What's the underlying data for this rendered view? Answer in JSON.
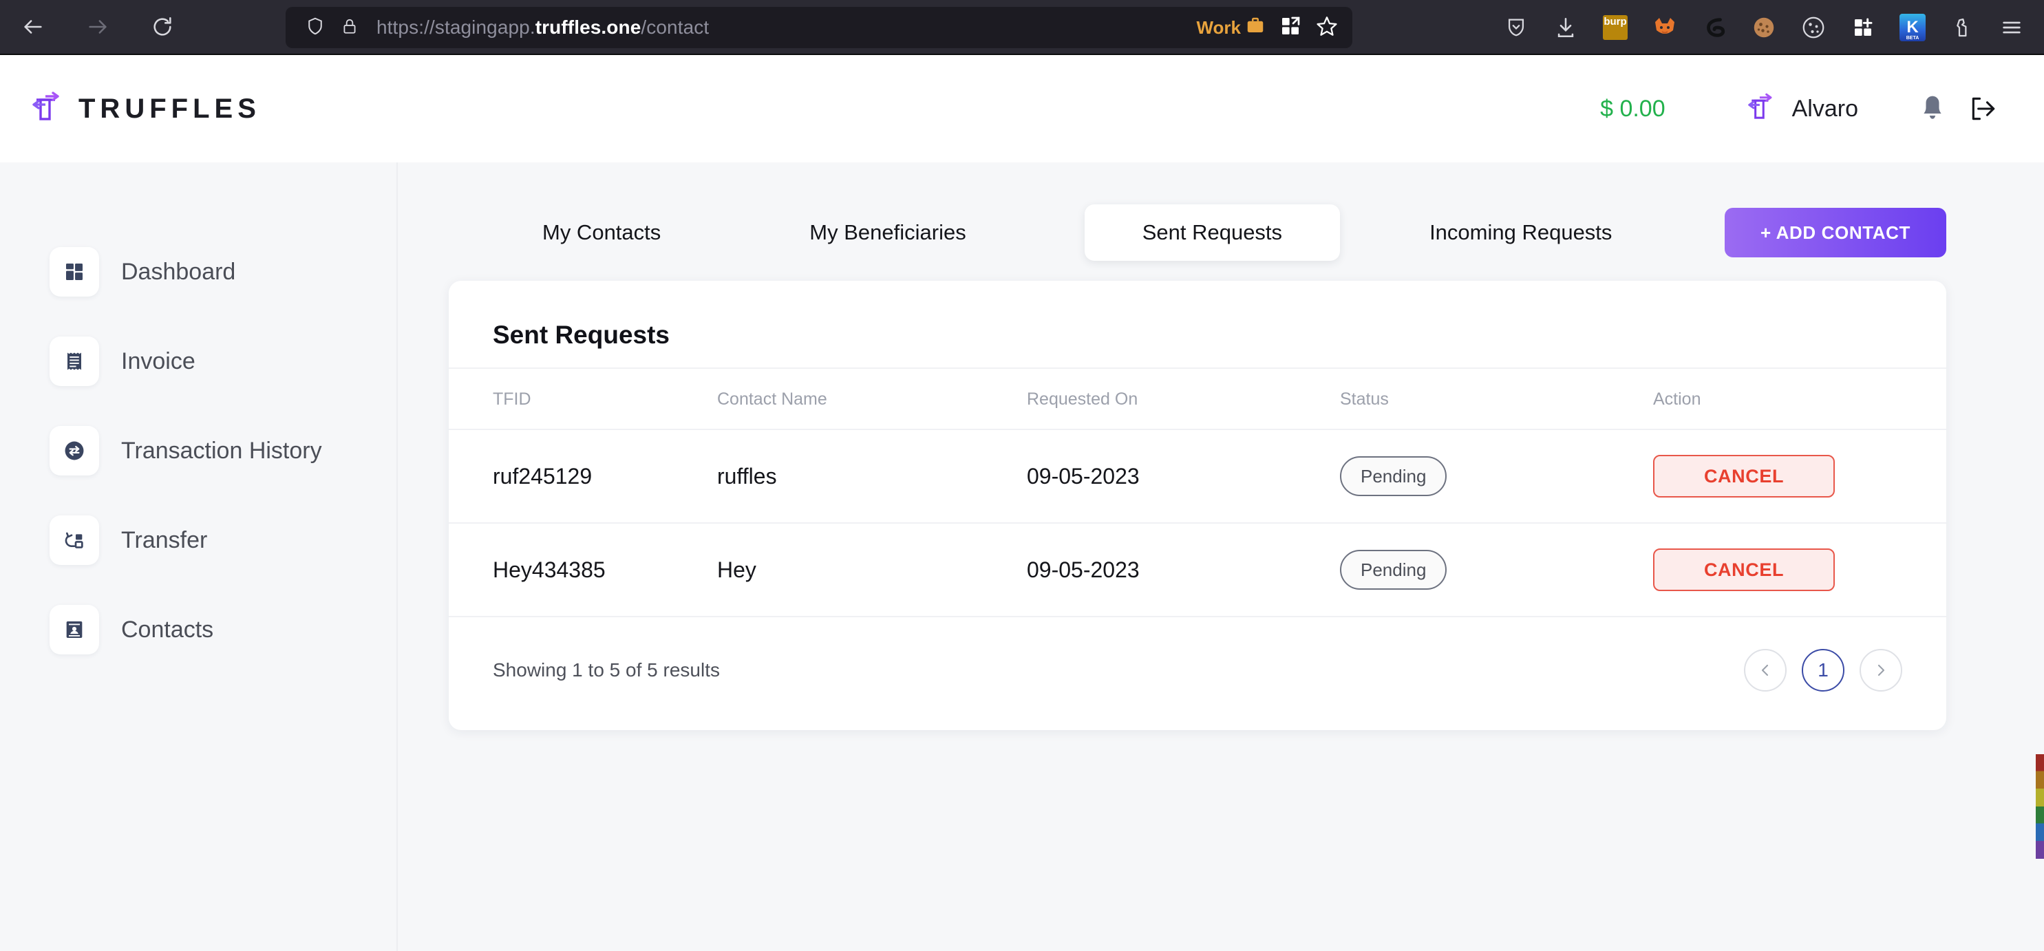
{
  "browser": {
    "url_prefix": "https://stagingapp.",
    "url_domain": "truffles.one",
    "url_path": "/contact",
    "back_icon": "back-arrow-icon",
    "forward_icon": "forward-arrow-icon",
    "reload_icon": "reload-icon",
    "shield_icon": "shield-icon",
    "lock_icon": "lock-icon",
    "work_label": "Work",
    "briefcase_icon": "briefcase-icon",
    "container_icon": "container-grid-icon",
    "bookmark_icon": "star-bookmark-icon",
    "extensions": [
      {
        "name": "pocket-icon",
        "glyph": "Ⓥ"
      },
      {
        "name": "downloads-icon",
        "glyph": "⤓"
      },
      {
        "name": "burp-suite-icon",
        "label": "burp"
      },
      {
        "name": "foxyproxy-icon",
        "glyph": "🦊"
      },
      {
        "name": "wappalyzer-icon",
        "glyph": "◔"
      },
      {
        "name": "cookie-editor-icon",
        "glyph": "🍪"
      },
      {
        "name": "cookie-quick-manager-icon",
        "glyph": "●"
      },
      {
        "name": "container-tabs-icon",
        "glyph": "⊞"
      },
      {
        "name": "kali-beta-icon",
        "label": "K"
      },
      {
        "name": "hack-tools-icon",
        "glyph": "✋"
      },
      {
        "name": "app-menu-icon",
        "glyph": "☰"
      }
    ]
  },
  "header": {
    "brand": "TRUFFLES",
    "logo_icon": "truffles-logo-icon",
    "balance": "$ 0.00",
    "user_avatar_icon": "truffles-avatar-icon",
    "user_name": "Alvaro",
    "notification_icon": "bell-icon",
    "logout_icon": "logout-icon",
    "balance_color": "#22b14c"
  },
  "sidebar": {
    "items": [
      {
        "label": "Dashboard",
        "icon": "dashboard-grid-icon"
      },
      {
        "label": "Invoice",
        "icon": "invoice-receipt-icon"
      },
      {
        "label": "Transaction History",
        "icon": "transaction-exchange-icon"
      },
      {
        "label": "Transfer",
        "icon": "transfer-arrow-icon"
      },
      {
        "label": "Contacts",
        "icon": "contacts-card-icon"
      }
    ]
  },
  "tabs": [
    {
      "label": "My Contacts",
      "active": false
    },
    {
      "label": "My Beneficiaries",
      "active": false
    },
    {
      "label": "Sent Requests",
      "active": true
    },
    {
      "label": "Incoming Requests",
      "active": false
    }
  ],
  "add_contact_button": {
    "label": "+ ADD CONTACT",
    "gradient_from": "#9b6bf2",
    "gradient_to": "#6b3ff0"
  },
  "card": {
    "title": "Sent Requests",
    "columns": [
      "TFID",
      "Contact Name",
      "Requested On",
      "Status",
      "Action"
    ],
    "rows": [
      {
        "tfid": "ruf245129",
        "contact_name": "ruffles",
        "requested_on": "09-05-2023",
        "status": "Pending",
        "action": "CANCEL"
      },
      {
        "tfid": "Hey434385",
        "contact_name": "Hey",
        "requested_on": "09-05-2023",
        "status": "Pending",
        "action": "CANCEL"
      }
    ],
    "footer": {
      "results_text": "Showing 1 to 5 of 5 results",
      "prev_icon": "chevron-left-icon",
      "next_icon": "chevron-right-icon",
      "current_page": "1"
    }
  },
  "colors": {
    "accent_purple": "#6b3ff0",
    "cancel_red": "#e8402f",
    "page_bg": "#f6f7f9"
  }
}
